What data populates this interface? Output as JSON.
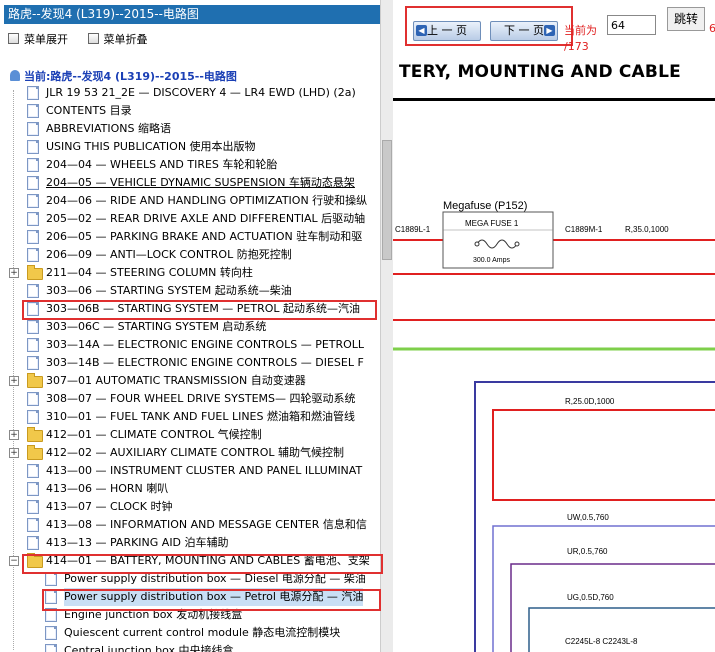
{
  "left": {
    "title": "路虎--发现4 (L319)--2015--电路图",
    "menu_expand": "菜单展开",
    "menu_collapse": "菜单折叠",
    "current": "当前:路虎--发现4 (L319)--2015--电路图",
    "items": [
      {
        "label": "JLR 19 53 21_2E — DISCOVERY 4 — LR4 EWD (LHD) (2a)",
        "kind": "doc"
      },
      {
        "label": "CONTENTS 目录",
        "kind": "doc"
      },
      {
        "label": "ABBREVIATIONS 缩略语",
        "kind": "doc"
      },
      {
        "label": "USING THIS PUBLICATION 使用本出版物",
        "kind": "doc"
      },
      {
        "label": "204—04 — WHEELS AND TIRES 车轮和轮胎",
        "kind": "doc"
      },
      {
        "label": "204—05 — VEHICLE DYNAMIC SUSPENSION 车辆动态悬架",
        "kind": "doc",
        "underline": true
      },
      {
        "label": "204—06 — RIDE AND HANDLING OPTIMIZATION 行驶和操纵",
        "kind": "doc"
      },
      {
        "label": "205—02 — REAR DRIVE AXLE AND DIFFERENTIAL 后驱动轴",
        "kind": "doc"
      },
      {
        "label": "206—05 — PARKING BRAKE AND ACTUATION 驻车制动和驱",
        "kind": "doc"
      },
      {
        "label": "206—09 — ANTI—LOCK CONTROL 防抱死控制",
        "kind": "doc"
      },
      {
        "label": "211—04 — STEERING COLUMN 转向柱",
        "kind": "folder",
        "expander": "+"
      },
      {
        "label": "303—06 — STARTING SYSTEM 起动系统—柴油",
        "kind": "doc"
      },
      {
        "label": "303—06B — STARTING SYSTEM — PETROL 起动系统—汽油",
        "kind": "doc"
      },
      {
        "label": "303—06C — STARTING SYSTEM 启动系统",
        "kind": "doc"
      },
      {
        "label": "303—14A — ELECTRONIC ENGINE CONTROLS — PETROLL",
        "kind": "doc"
      },
      {
        "label": "303—14B — ELECTRONIC ENGINE CONTROLS — DIESEL F",
        "kind": "doc"
      },
      {
        "label": "307—01 AUTOMATIC TRANSMISSION 自动变速器",
        "kind": "folder",
        "expander": "+"
      },
      {
        "label": "308—07 — FOUR WHEEL DRIVE SYSTEMS— 四轮驱动系统",
        "kind": "doc"
      },
      {
        "label": "310—01 — FUEL TANK AND FUEL LINES 燃油箱和燃油管线",
        "kind": "doc"
      },
      {
        "label": "412—01 — CLIMATE CONTROL 气候控制",
        "kind": "folder",
        "expander": "+"
      },
      {
        "label": "412—02 — AUXILIARY CLIMATE CONTROL 辅助气候控制",
        "kind": "folder",
        "expander": "+"
      },
      {
        "label": "413—00 — INSTRUMENT CLUSTER AND PANEL ILLUMINAT",
        "kind": "doc"
      },
      {
        "label": "413—06 — HORN 喇叭",
        "kind": "doc"
      },
      {
        "label": "413—07 — CLOCK 时钟",
        "kind": "doc"
      },
      {
        "label": "413—08 — INFORMATION AND MESSAGE CENTER 信息和信",
        "kind": "doc"
      },
      {
        "label": "413—13 — PARKING AID 泊车辅助",
        "kind": "doc"
      },
      {
        "label": "414—01 — BATTERY, MOUNTING AND CABLES 蓄电池、支架",
        "kind": "folder",
        "expander": "−"
      },
      {
        "label": "Power supply distribution box — Diesel 电源分配 — 柴油",
        "kind": "doc",
        "child": true
      },
      {
        "label": "Power supply distribution box — Petrol 电源分配 — 汽油",
        "kind": "doc",
        "child": true,
        "selected": true
      },
      {
        "label": "Engine junction box 发动机接线盒",
        "kind": "doc",
        "child": true
      },
      {
        "label": "Quiescent current control module 静态电流控制模块",
        "kind": "doc",
        "child": true
      },
      {
        "label": "Central junction box 中央接线盒",
        "kind": "doc",
        "child": true
      }
    ]
  },
  "toolbar": {
    "prev_label": "上 一 页",
    "next_label": "下 一 页",
    "page_label": "当前为",
    "page_total": "/173",
    "page_value": "64",
    "go_label": "跳转",
    "edge_mark": "6"
  },
  "diagram": {
    "title": "TERY, MOUNTING AND CABLE",
    "megafuse_label": "Megafuse (P152)",
    "fuse_name": "MEGA FUSE 1",
    "fuse_rating": "300.0 Amps",
    "left_connector": "C1889L-1",
    "right_connector": "C1889M-1",
    "right_wire": "R,35.0,1000",
    "wire_r": "R,25.0D,1000",
    "wire_uw": "UW,0.5,760",
    "wire_ur": "UR,0.5,760",
    "wire_ug": "UG,0.5D,760",
    "bottom_conn": "C2245L-8 C2243L-8"
  }
}
